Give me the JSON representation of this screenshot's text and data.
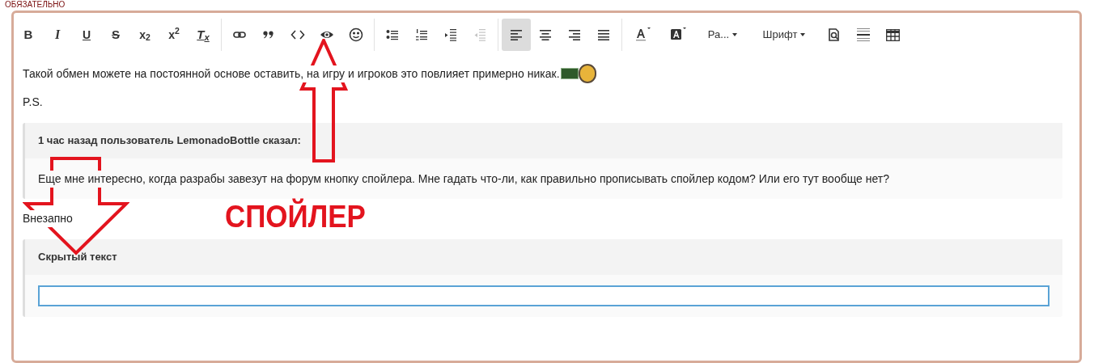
{
  "field_label": "ОБЯЗАТЕЛЬНО",
  "toolbar": {
    "groups": [
      [
        {
          "kind": "bold",
          "label": "B",
          "selected": false,
          "disabled": false
        },
        {
          "kind": "italic",
          "label": "I",
          "selected": false,
          "disabled": false
        },
        {
          "kind": "underline",
          "label": "U",
          "selected": false,
          "disabled": false
        },
        {
          "kind": "strike",
          "label": "S",
          "selected": false,
          "disabled": false
        },
        {
          "kind": "script",
          "label": "x$_{2}$",
          "selected": false,
          "disabled": false
        },
        {
          "kind": "script",
          "label": "x$^{2}$",
          "selected": false,
          "disabled": false
        },
        {
          "kind": "clear",
          "label": "T$_{x}$",
          "selected": false,
          "disabled": false
        }
      ],
      [
        {
          "kind": "link",
          "selected": false,
          "disabled": false
        },
        {
          "kind": "quote",
          "selected": false,
          "disabled": false
        },
        {
          "kind": "code",
          "selected": false,
          "disabled": false
        },
        {
          "kind": "spoiler",
          "selected": false,
          "disabled": false
        },
        {
          "kind": "smiley",
          "selected": false,
          "disabled": false
        }
      ],
      [
        {
          "kind": "bullets",
          "selected": false,
          "disabled": false
        },
        {
          "kind": "numbers",
          "selected": false,
          "disabled": false
        },
        {
          "kind": "indent",
          "selected": false,
          "disabled": false
        },
        {
          "kind": "outdent",
          "selected": false,
          "disabled": true
        }
      ],
      [
        {
          "kind": "align-left",
          "selected": true,
          "disabled": false
        },
        {
          "kind": "align-center",
          "selected": false,
          "disabled": false
        },
        {
          "kind": "align-right",
          "selected": false,
          "disabled": false
        },
        {
          "kind": "justify",
          "selected": false,
          "disabled": false
        }
      ],
      [
        {
          "kind": "text-color",
          "selected": false,
          "disabled": false
        },
        {
          "kind": "back-color",
          "selected": false,
          "disabled": false
        },
        {
          "kind": "dropdown",
          "label": "Ра...",
          "selected": false,
          "disabled": false
        },
        {
          "kind": "dropdown",
          "label": "Шрифт",
          "selected": false,
          "disabled": false
        },
        {
          "kind": "preview",
          "selected": false,
          "disabled": false
        },
        {
          "kind": "rule",
          "selected": false,
          "disabled": false
        },
        {
          "kind": "table",
          "selected": false,
          "disabled": false
        }
      ]
    ]
  },
  "content": [
    {
      "kind": "paragraph",
      "text": "Такой обмен можете на постоянной основе оставить, на игру и игроков это повлияет примерно никак.",
      "emoticons": [
        {
          "kind": "sign"
        },
        {
          "kind": "face"
        }
      ]
    },
    {
      "kind": "paragraph",
      "text": "P.S."
    },
    {
      "kind": "quote",
      "header": "1 час назад пользователь LemonadoBottle сказал:",
      "body": "Еще мне интересно, когда разрабы завезут на форум кнопку спойлера. Мне гадать что-ли, как правильно прописывать спойлер кодом? Или его тут вообще нет?"
    },
    {
      "kind": "paragraph",
      "text": "Внезапно"
    },
    {
      "kind": "spoiler",
      "header": "Скрытый текст",
      "focused": true
    }
  ],
  "annotations": [
    {
      "kind": "up-arrow"
    },
    {
      "kind": "down-arrow"
    },
    {
      "kind": "label",
      "text": "СПОЙЛЕР"
    }
  ]
}
